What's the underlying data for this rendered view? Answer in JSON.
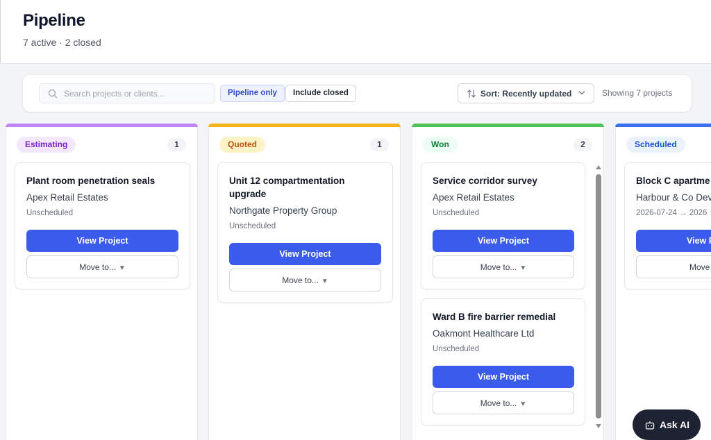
{
  "header": {
    "title": "Pipeline",
    "subtitle": "7 active · 2 closed"
  },
  "toolbar": {
    "search_placeholder": "Search projects or clients...",
    "filter_pipeline": "Pipeline only",
    "filter_closed": "Include closed",
    "sort_label": "Sort: Recently updated",
    "showing": "Showing 7 projects"
  },
  "columns": [
    {
      "name": "Estimating",
      "count": "1",
      "color": "#c084fc",
      "badge_bg": "#f3e8ff",
      "badge_fg": "#7e22ce",
      "cards": [
        {
          "title": "Plant room penetration seals",
          "client": "Apex Retail Estates",
          "schedule": "Unscheduled",
          "view": "View Project",
          "move": "Move to..."
        }
      ]
    },
    {
      "name": "Quoted",
      "count": "1",
      "color": "#f5b31b",
      "badge_bg": "#fef3c7",
      "badge_fg": "#b45309",
      "cards": [
        {
          "title": "Unit 12 compartmentation upgrade",
          "client": "Northgate Property Group",
          "schedule": "Unscheduled",
          "view": "View Project",
          "move": "Move to..."
        }
      ]
    },
    {
      "name": "Won",
      "count": "2",
      "color": "#4fc25a",
      "badge_bg": "#ecfdf3",
      "badge_fg": "#15803d",
      "cards": [
        {
          "title": "Service corridor survey",
          "client": "Apex Retail Estates",
          "schedule": "Unscheduled",
          "view": "View Project",
          "move": "Move to..."
        },
        {
          "title": "Ward B fire barrier remedial",
          "client": "Oakmont Healthcare Ltd",
          "schedule": "Unscheduled",
          "view": "View Project",
          "move": "Move to..."
        }
      ]
    },
    {
      "name": "Scheduled",
      "count": "",
      "color": "#3b6ff0",
      "badge_bg": "#eaf1ff",
      "badge_fg": "#1d4ed8",
      "cards": [
        {
          "title": "Block C apartme",
          "client": "Harbour & Co Dev",
          "schedule": "2026-07-24 → 2026",
          "view": "View P",
          "move": "Move"
        }
      ]
    }
  ],
  "assistant": {
    "label": "Ask AI"
  }
}
